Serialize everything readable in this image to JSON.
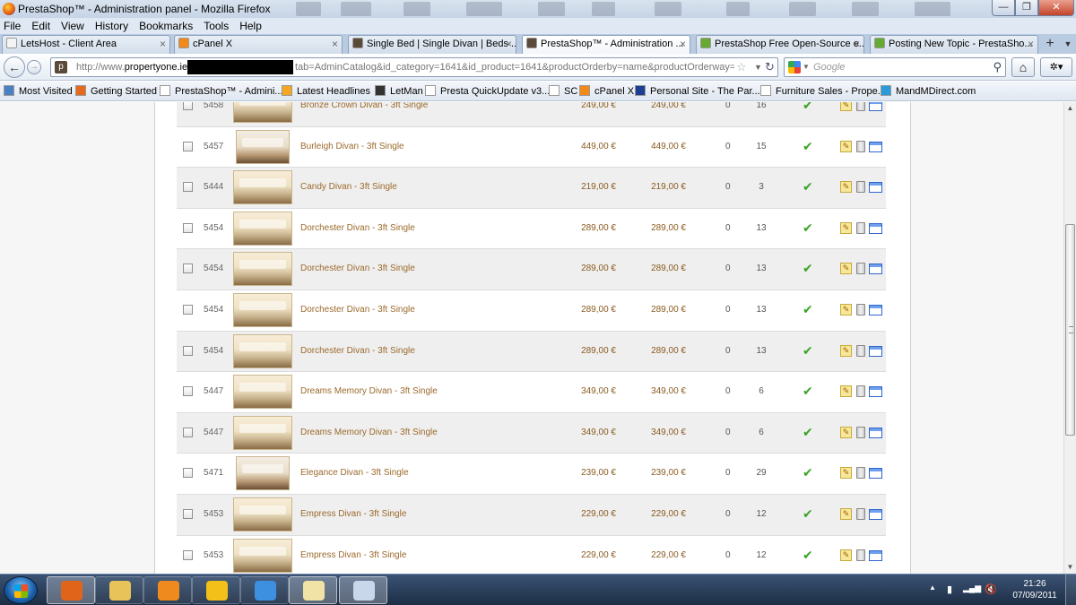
{
  "window": {
    "title": "PrestaShop™ - Administration panel - Mozilla Firefox",
    "minimize_glyph": "—",
    "maximize_glyph": "❐",
    "close_glyph": "✕"
  },
  "menu": [
    "File",
    "Edit",
    "View",
    "History",
    "Bookmarks",
    "Tools",
    "Help"
  ],
  "tabs": [
    {
      "label": "LetsHost - Client Area",
      "icon_color": "#f4f4f4"
    },
    {
      "label": "cPanel X",
      "icon_color": "#f28a1a"
    },
    {
      "label": "Single Bed | Single Divan | Beds ...",
      "icon_color": "#5a4a3a"
    },
    {
      "label": "PrestaShop™ - Administration ...",
      "icon_color": "#5a4a3a"
    },
    {
      "label": "PrestaShop Free Open-Source e...",
      "icon_color": "#66aa33"
    },
    {
      "label": "Posting New Topic - PrestaSho...",
      "icon_color": "#66aa33"
    }
  ],
  "tab_close_glyph": "×",
  "new_tab_glyph": "+",
  "tab_list_glyph": "▼",
  "navbar": {
    "back_glyph": "←",
    "forward_glyph": "→",
    "url_prefix": "http://www.",
    "url_domain": "propertyone.ie",
    "url_rest": "tab=AdminCatalog&id_category=1641&id_product=1641&productOrderby=name&productOrderway=as",
    "site_icon_letter": "p",
    "bookmark_star_glyph": "☆",
    "dropdown_glyph": "▼",
    "reload_glyph": "↻",
    "search_placeholder": "Google",
    "search_glyph": "⚲",
    "home_glyph": "⌂",
    "addon_glyph": "✲▾"
  },
  "bookmarks": [
    {
      "label": "Most Visited",
      "icon_color": "#4a7fc1"
    },
    {
      "label": "Getting Started",
      "icon_color": "#e66a1e"
    },
    {
      "label": "PrestaShop™ - Admini...",
      "icon_color": "#ffffff"
    },
    {
      "label": "Latest Headlines",
      "icon_color": "#f5a623"
    },
    {
      "label": "LetMan",
      "icon_color": "#333333"
    },
    {
      "label": "Presta QuickUpdate v3....",
      "icon_color": "#ffffff"
    },
    {
      "label": "SC",
      "icon_color": "#ffffff"
    },
    {
      "label": "cPanel X",
      "icon_color": "#f28a1a"
    },
    {
      "label": "Personal Site - The Par...",
      "icon_color": "#1c3f94"
    },
    {
      "label": "Furniture Sales - Prope...",
      "icon_color": "#ffffff"
    },
    {
      "label": "MandMDirect.com",
      "icon_color": "#2a9bd6"
    }
  ],
  "products": [
    {
      "id": "5458",
      "name": "Bronze Crown Divan - 3ft Single",
      "price": "249,00 €",
      "price_tax": "249,00 €",
      "qty_a": "0",
      "qty_b": "16"
    },
    {
      "id": "5457",
      "name": "Burleigh Divan - 3ft Single",
      "price": "449,00 €",
      "price_tax": "449,00 €",
      "qty_a": "0",
      "qty_b": "15"
    },
    {
      "id": "5444",
      "name": "Candy Divan - 3ft Single",
      "price": "219,00 €",
      "price_tax": "219,00 €",
      "qty_a": "0",
      "qty_b": "3"
    },
    {
      "id": "5454",
      "name": "Dorchester Divan - 3ft Single",
      "price": "289,00 €",
      "price_tax": "289,00 €",
      "qty_a": "0",
      "qty_b": "13"
    },
    {
      "id": "5454",
      "name": "Dorchester Divan - 3ft Single",
      "price": "289,00 €",
      "price_tax": "289,00 €",
      "qty_a": "0",
      "qty_b": "13"
    },
    {
      "id": "5454",
      "name": "Dorchester Divan - 3ft Single",
      "price": "289,00 €",
      "price_tax": "289,00 €",
      "qty_a": "0",
      "qty_b": "13"
    },
    {
      "id": "5454",
      "name": "Dorchester Divan - 3ft Single",
      "price": "289,00 €",
      "price_tax": "289,00 €",
      "qty_a": "0",
      "qty_b": "13"
    },
    {
      "id": "5447",
      "name": "Dreams Memory Divan - 3ft Single",
      "price": "349,00 €",
      "price_tax": "349,00 €",
      "qty_a": "0",
      "qty_b": "6"
    },
    {
      "id": "5447",
      "name": "Dreams Memory Divan - 3ft Single",
      "price": "349,00 €",
      "price_tax": "349,00 €",
      "qty_a": "0",
      "qty_b": "6"
    },
    {
      "id": "5471",
      "name": "Elegance Divan - 3ft Single",
      "price": "239,00 €",
      "price_tax": "239,00 €",
      "qty_a": "0",
      "qty_b": "29"
    },
    {
      "id": "5453",
      "name": "Empress Divan - 3ft Single",
      "price": "229,00 €",
      "price_tax": "229,00 €",
      "qty_a": "0",
      "qty_b": "12"
    },
    {
      "id": "5453",
      "name": "Empress Divan - 3ft Single",
      "price": "229,00 €",
      "price_tax": "229,00 €",
      "qty_a": "0",
      "qty_b": "12"
    }
  ],
  "status_glyph": "✔",
  "edit_glyph": "✎",
  "scroll_up_glyph": "▲",
  "scroll_down_glyph": "▼",
  "taskbar": {
    "apps": [
      {
        "name": "firefox",
        "color": "#e0651b",
        "active": true
      },
      {
        "name": "file-explorer",
        "color": "#e8c35a",
        "active": false
      },
      {
        "name": "media-player",
        "color": "#ef8a1f",
        "active": false
      },
      {
        "name": "transfer-app",
        "color": "#f3c01a",
        "active": false
      },
      {
        "name": "internet-explorer",
        "color": "#3d8fe0",
        "active": false
      },
      {
        "name": "folder-window",
        "color": "#f0e3a5",
        "active": true
      },
      {
        "name": "remote-desktop",
        "color": "#c9d7ea",
        "active": true
      }
    ],
    "tray_up_glyph": "▲",
    "tray_battery_glyph": "▮",
    "tray_signal_glyph": "▂▄▆",
    "tray_volume_glyph": "🔇",
    "time": "21:26",
    "date": "07/09/2011"
  }
}
